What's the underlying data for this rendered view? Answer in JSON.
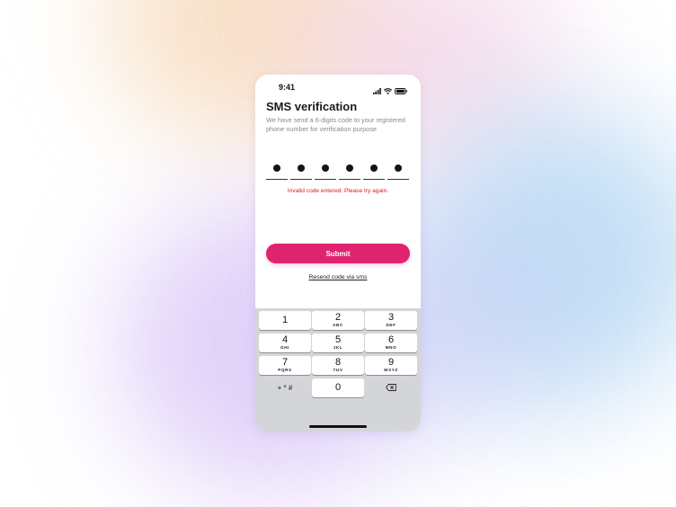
{
  "status_bar": {
    "time": "9:41",
    "icons": [
      "signal-icon",
      "wifi-icon",
      "battery-icon"
    ]
  },
  "screen": {
    "title": "SMS verification",
    "subtitle": "We have send a 6-digits code to your registered phone number for verification purpose",
    "otp_digit_count": 6,
    "otp_filled_count": 6,
    "error_message": "Invalid code entered. Please try again.",
    "submit_label": "Submit",
    "resend_label": "Resend code via sms"
  },
  "keypad": {
    "keys": [
      {
        "digit": "1",
        "letters": ""
      },
      {
        "digit": "2",
        "letters": "ABC"
      },
      {
        "digit": "3",
        "letters": "DEF"
      },
      {
        "digit": "4",
        "letters": "GHI"
      },
      {
        "digit": "5",
        "letters": "JKL"
      },
      {
        "digit": "6",
        "letters": "MNO"
      },
      {
        "digit": "7",
        "letters": "PQRS"
      },
      {
        "digit": "8",
        "letters": "TUV"
      },
      {
        "digit": "9",
        "letters": "WXYZ"
      },
      {
        "digit": "0",
        "letters": ""
      }
    ],
    "symbols_label": "+ * #",
    "delete_icon": "backspace-icon"
  },
  "colors": {
    "accent": "#e0236f",
    "error": "#e01818",
    "keyboard_bg": "#d4d5d9"
  }
}
